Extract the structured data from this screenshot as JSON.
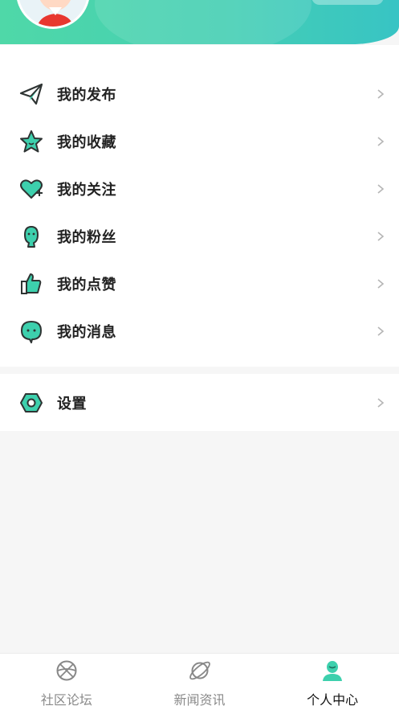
{
  "colors": {
    "accent": "#3dd0ad",
    "accent_dark": "#2b9f86",
    "text": "#222222",
    "muted": "#8a8a8a"
  },
  "menu": {
    "items": [
      {
        "label": "我的发布",
        "icon": "paper-plane-icon"
      },
      {
        "label": "我的收藏",
        "icon": "star-icon"
      },
      {
        "label": "我的关注",
        "icon": "heart-plus-icon"
      },
      {
        "label": "我的粉丝",
        "icon": "person-icon"
      },
      {
        "label": "我的点赞",
        "icon": "thumbs-up-icon"
      },
      {
        "label": "我的消息",
        "icon": "chat-bubble-icon"
      }
    ]
  },
  "settings": {
    "label": "设置",
    "icon": "gear-icon"
  },
  "tabbar": {
    "tabs": [
      {
        "label": "社区论坛",
        "icon": "ball-icon",
        "active": false
      },
      {
        "label": "新闻资讯",
        "icon": "planet-icon",
        "active": false
      },
      {
        "label": "个人中心",
        "icon": "user-icon",
        "active": true
      }
    ]
  }
}
